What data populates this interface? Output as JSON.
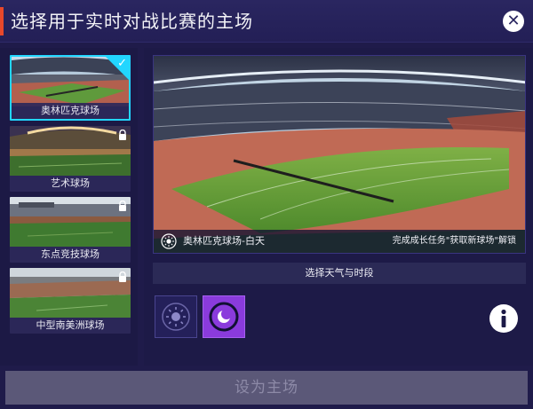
{
  "header": {
    "title": "选择用于实时对战比赛的主场"
  },
  "stadiums": [
    {
      "label": "奥林匹克球场",
      "selected": true,
      "locked": false
    },
    {
      "label": "艺术球场",
      "selected": false,
      "locked": true
    },
    {
      "label": "东点竞技球场",
      "selected": false,
      "locked": true
    },
    {
      "label": "中型南美洲球场",
      "selected": false,
      "locked": true
    }
  ],
  "preview": {
    "caption_name": "奥林匹克球场-白天",
    "caption_note": "完成成长任务\"获取新球场\"解锁"
  },
  "weather_section": {
    "label": "选择天气与时段"
  },
  "footer": {
    "set_home_label": "设为主场"
  },
  "colors": {
    "accent": "#22d6ff",
    "night_button": "#8a3bdc",
    "header_marker": "#e8482b"
  }
}
